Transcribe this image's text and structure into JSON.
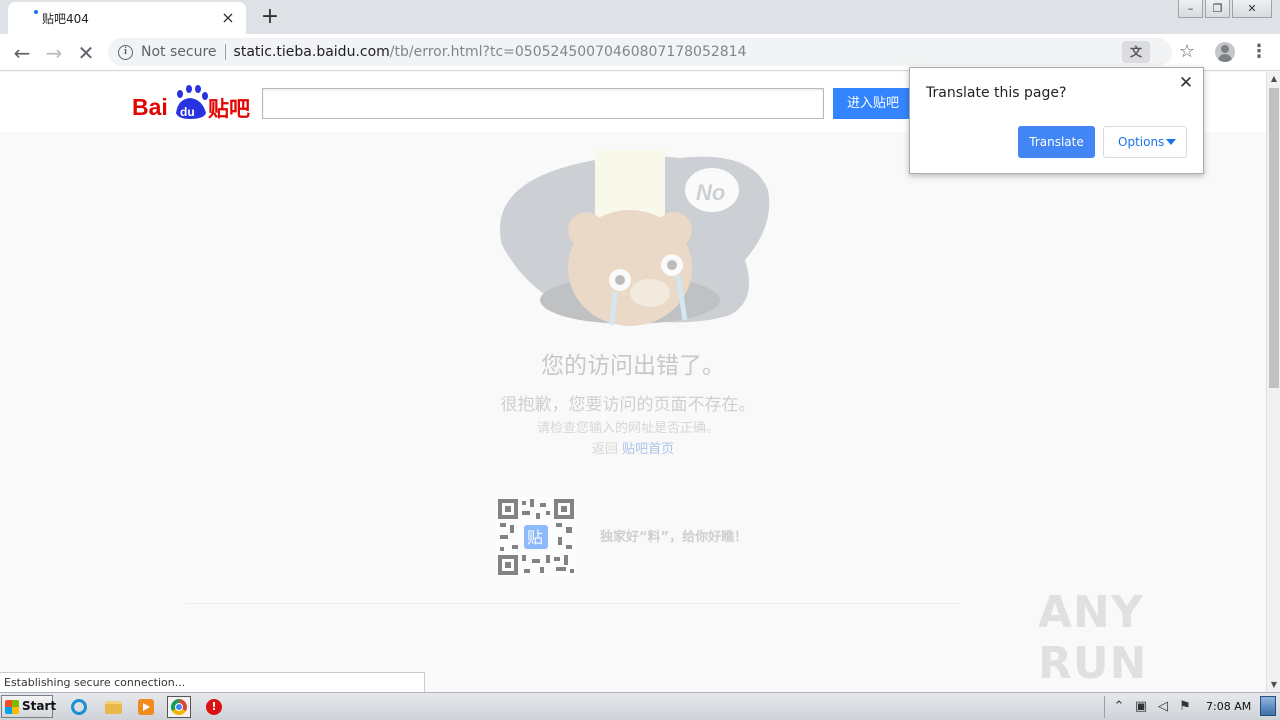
{
  "tab": {
    "title": "贴吧404"
  },
  "address_bar": {
    "security": "Not secure",
    "host": "static.tieba.baidu.com",
    "path": "/tb/error.html?tc=05052450070460807178052814"
  },
  "header": {
    "logo_text": "Bai du 贴吧",
    "search_placeholder": "",
    "enter_button": "进入贴吧"
  },
  "error": {
    "illustration_text": "No",
    "title": "您的访问出错了。",
    "subtitle": "很抱歉，您要访问的页面不存在。",
    "hint": "请检查您输入的网址是否正确。",
    "back_prefix": "返回",
    "back_link": "贴吧首页",
    "qr_badge": "贴",
    "qr_caption": "独家好“料”，给你好瞧！"
  },
  "status_bar": "Establishing secure connection...",
  "translate_popup": {
    "title": "Translate this page?",
    "translate_button": "Translate",
    "options_button": "Options"
  },
  "watermark": "ANY RUN",
  "taskbar": {
    "start_label": "Start",
    "clock": "7:08 AM"
  },
  "colors": {
    "accent": "#3385ff",
    "translate_blue": "#4285f4",
    "baidu_red": "#e10602",
    "baidu_blue": "#2932e1"
  }
}
